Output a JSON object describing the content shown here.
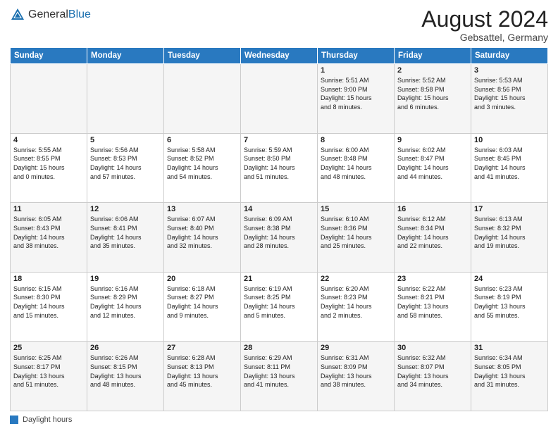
{
  "header": {
    "logo_general": "General",
    "logo_blue": "Blue",
    "month_year": "August 2024",
    "location": "Gebsattel, Germany"
  },
  "footer": {
    "label": "Daylight hours"
  },
  "days_of_week": [
    "Sunday",
    "Monday",
    "Tuesday",
    "Wednesday",
    "Thursday",
    "Friday",
    "Saturday"
  ],
  "weeks": [
    [
      {
        "day": "",
        "info": ""
      },
      {
        "day": "",
        "info": ""
      },
      {
        "day": "",
        "info": ""
      },
      {
        "day": "",
        "info": ""
      },
      {
        "day": "1",
        "info": "Sunrise: 5:51 AM\nSunset: 9:00 PM\nDaylight: 15 hours\nand 8 minutes."
      },
      {
        "day": "2",
        "info": "Sunrise: 5:52 AM\nSunset: 8:58 PM\nDaylight: 15 hours\nand 6 minutes."
      },
      {
        "day": "3",
        "info": "Sunrise: 5:53 AM\nSunset: 8:56 PM\nDaylight: 15 hours\nand 3 minutes."
      }
    ],
    [
      {
        "day": "4",
        "info": "Sunrise: 5:55 AM\nSunset: 8:55 PM\nDaylight: 15 hours\nand 0 minutes."
      },
      {
        "day": "5",
        "info": "Sunrise: 5:56 AM\nSunset: 8:53 PM\nDaylight: 14 hours\nand 57 minutes."
      },
      {
        "day": "6",
        "info": "Sunrise: 5:58 AM\nSunset: 8:52 PM\nDaylight: 14 hours\nand 54 minutes."
      },
      {
        "day": "7",
        "info": "Sunrise: 5:59 AM\nSunset: 8:50 PM\nDaylight: 14 hours\nand 51 minutes."
      },
      {
        "day": "8",
        "info": "Sunrise: 6:00 AM\nSunset: 8:48 PM\nDaylight: 14 hours\nand 48 minutes."
      },
      {
        "day": "9",
        "info": "Sunrise: 6:02 AM\nSunset: 8:47 PM\nDaylight: 14 hours\nand 44 minutes."
      },
      {
        "day": "10",
        "info": "Sunrise: 6:03 AM\nSunset: 8:45 PM\nDaylight: 14 hours\nand 41 minutes."
      }
    ],
    [
      {
        "day": "11",
        "info": "Sunrise: 6:05 AM\nSunset: 8:43 PM\nDaylight: 14 hours\nand 38 minutes."
      },
      {
        "day": "12",
        "info": "Sunrise: 6:06 AM\nSunset: 8:41 PM\nDaylight: 14 hours\nand 35 minutes."
      },
      {
        "day": "13",
        "info": "Sunrise: 6:07 AM\nSunset: 8:40 PM\nDaylight: 14 hours\nand 32 minutes."
      },
      {
        "day": "14",
        "info": "Sunrise: 6:09 AM\nSunset: 8:38 PM\nDaylight: 14 hours\nand 28 minutes."
      },
      {
        "day": "15",
        "info": "Sunrise: 6:10 AM\nSunset: 8:36 PM\nDaylight: 14 hours\nand 25 minutes."
      },
      {
        "day": "16",
        "info": "Sunrise: 6:12 AM\nSunset: 8:34 PM\nDaylight: 14 hours\nand 22 minutes."
      },
      {
        "day": "17",
        "info": "Sunrise: 6:13 AM\nSunset: 8:32 PM\nDaylight: 14 hours\nand 19 minutes."
      }
    ],
    [
      {
        "day": "18",
        "info": "Sunrise: 6:15 AM\nSunset: 8:30 PM\nDaylight: 14 hours\nand 15 minutes."
      },
      {
        "day": "19",
        "info": "Sunrise: 6:16 AM\nSunset: 8:29 PM\nDaylight: 14 hours\nand 12 minutes."
      },
      {
        "day": "20",
        "info": "Sunrise: 6:18 AM\nSunset: 8:27 PM\nDaylight: 14 hours\nand 9 minutes."
      },
      {
        "day": "21",
        "info": "Sunrise: 6:19 AM\nSunset: 8:25 PM\nDaylight: 14 hours\nand 5 minutes."
      },
      {
        "day": "22",
        "info": "Sunrise: 6:20 AM\nSunset: 8:23 PM\nDaylight: 14 hours\nand 2 minutes."
      },
      {
        "day": "23",
        "info": "Sunrise: 6:22 AM\nSunset: 8:21 PM\nDaylight: 13 hours\nand 58 minutes."
      },
      {
        "day": "24",
        "info": "Sunrise: 6:23 AM\nSunset: 8:19 PM\nDaylight: 13 hours\nand 55 minutes."
      }
    ],
    [
      {
        "day": "25",
        "info": "Sunrise: 6:25 AM\nSunset: 8:17 PM\nDaylight: 13 hours\nand 51 minutes."
      },
      {
        "day": "26",
        "info": "Sunrise: 6:26 AM\nSunset: 8:15 PM\nDaylight: 13 hours\nand 48 minutes."
      },
      {
        "day": "27",
        "info": "Sunrise: 6:28 AM\nSunset: 8:13 PM\nDaylight: 13 hours\nand 45 minutes."
      },
      {
        "day": "28",
        "info": "Sunrise: 6:29 AM\nSunset: 8:11 PM\nDaylight: 13 hours\nand 41 minutes."
      },
      {
        "day": "29",
        "info": "Sunrise: 6:31 AM\nSunset: 8:09 PM\nDaylight: 13 hours\nand 38 minutes."
      },
      {
        "day": "30",
        "info": "Sunrise: 6:32 AM\nSunset: 8:07 PM\nDaylight: 13 hours\nand 34 minutes."
      },
      {
        "day": "31",
        "info": "Sunrise: 6:34 AM\nSunset: 8:05 PM\nDaylight: 13 hours\nand 31 minutes."
      }
    ]
  ]
}
